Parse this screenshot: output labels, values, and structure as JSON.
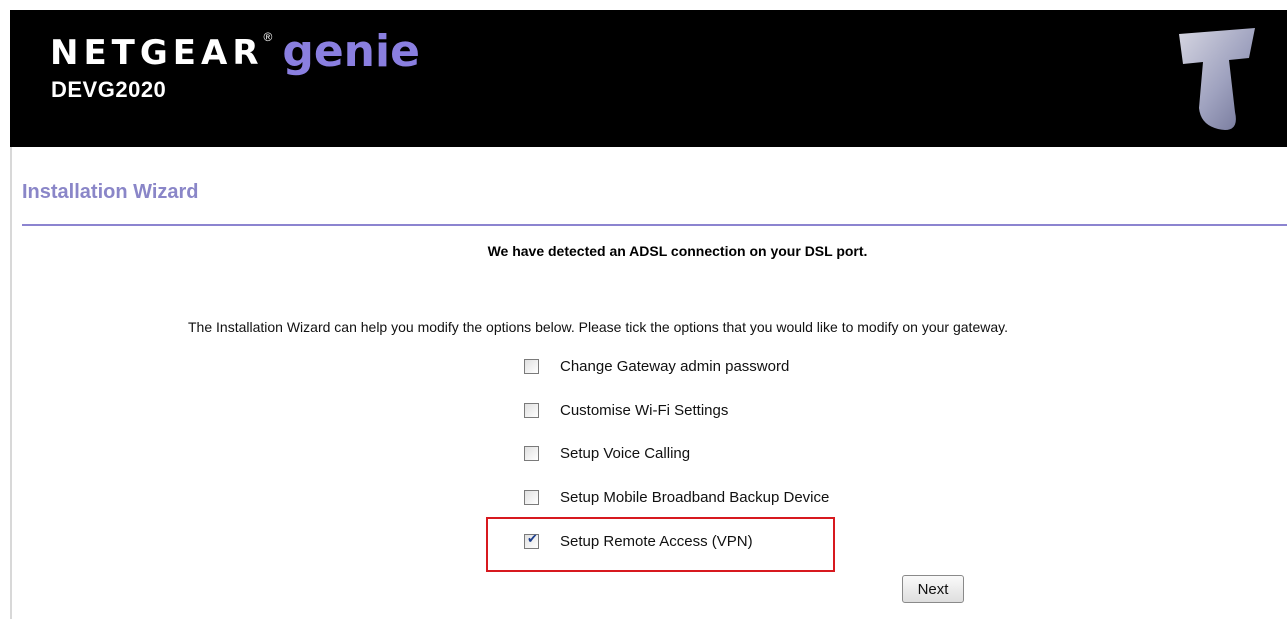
{
  "header": {
    "brand_name": "NETGEAR",
    "brand_mark": "®",
    "product_name": "genie",
    "model": "DEVG2020",
    "logo_icon": "telstra-t-logo-icon",
    "background_color": "#000000",
    "genie_color": "#8a7fe0"
  },
  "wizard": {
    "title": "Installation Wizard",
    "accent_color": "#8c84d0",
    "detect_message": "We have detected an ADSL connection on your DSL port.",
    "intro": "The Installation Wizard can help you modify the options below.  Please tick the options that you would like to modify on your gateway.",
    "options": [
      {
        "label": "Change Gateway admin password",
        "checked": false
      },
      {
        "label": "Customise Wi-Fi Settings",
        "checked": false
      },
      {
        "label": "Setup Voice Calling",
        "checked": false
      },
      {
        "label": "Setup Mobile Broadband Backup Device",
        "checked": false
      },
      {
        "label": "Setup Remote Access (VPN)",
        "checked": true
      }
    ],
    "highlight_color": "#d7191f",
    "next_label": "Next"
  }
}
